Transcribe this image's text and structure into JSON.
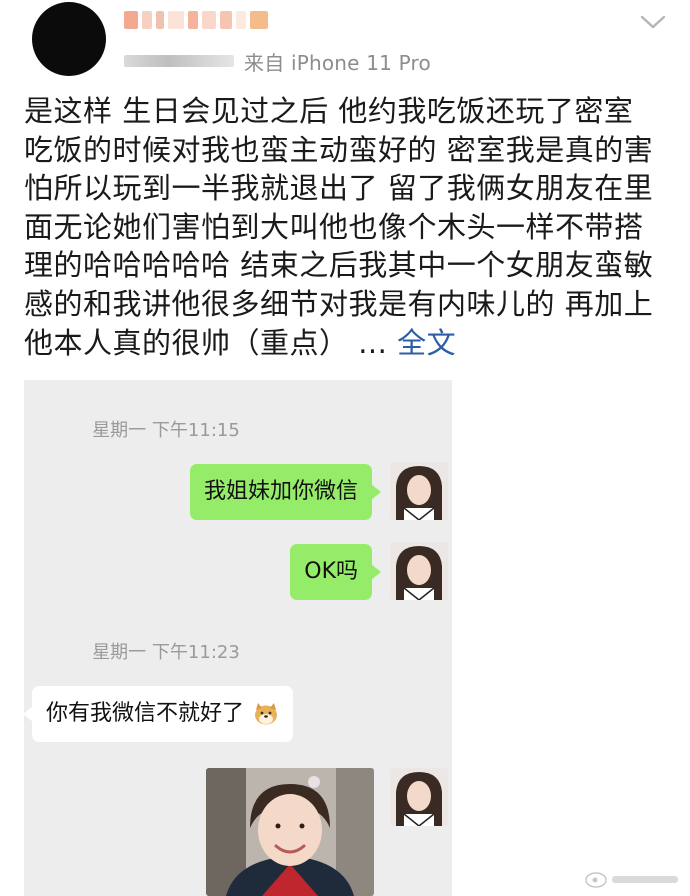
{
  "post": {
    "source": "来自 iPhone 11 Pro",
    "body": "是这样 生日会见过之后 他约我吃饭还玩了密室 吃饭的时候对我也蛮主动蛮好的 密室我是真的害怕所以玩到一半我就退出了 留了我俩女朋友在里面无论她们害怕到大叫他也像个木头一样不带搭理的哈哈哈哈哈 结束之后我其中一个女朋友蛮敏感的和我讲他很多细节对我是有内味儿的 再加上他本人真的很帅（重点） ...",
    "more_label": "全文"
  },
  "chat": {
    "time1": "星期一 下午11:15",
    "msg1": "我姐妹加你微信",
    "msg2": "OK吗",
    "time2": "星期一 下午11:23",
    "msg3": "你有我微信不就好了"
  },
  "icons": {
    "dropdown": "chevron-down-icon",
    "emoji": "doge-emoji-icon"
  },
  "colors": {
    "link": "#2b5ea5",
    "bubble_green": "#95ec69",
    "chat_bg": "#ededed"
  }
}
